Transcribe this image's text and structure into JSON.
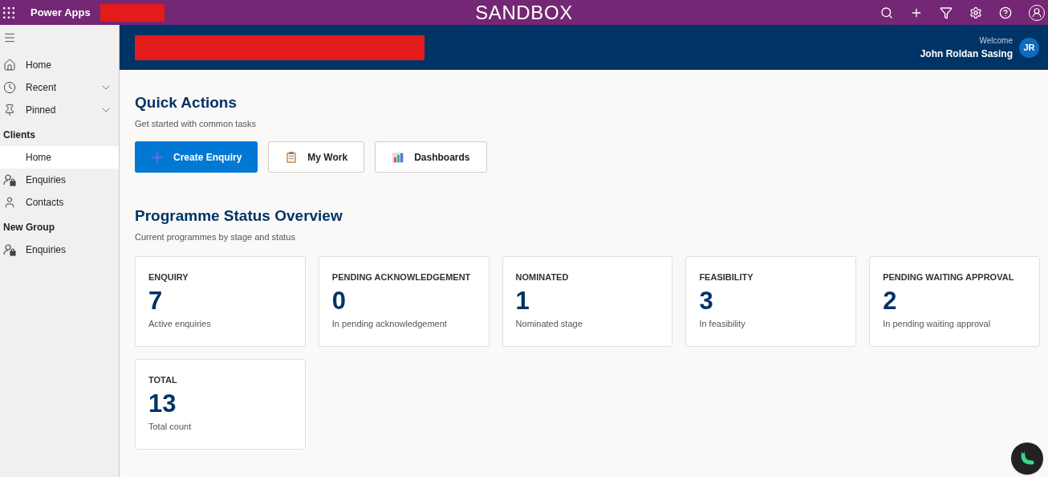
{
  "app_bar": {
    "app_name": "Power Apps",
    "environment": "SANDBOX"
  },
  "header": {
    "welcome": "Welcome",
    "user_name": "John Roldan Sasing",
    "initials": "JR"
  },
  "sidebar": {
    "items": [
      {
        "kind": "link",
        "label": "Home",
        "selected": false
      },
      {
        "kind": "expandable",
        "label": "Recent",
        "selected": false,
        "expanded": false
      },
      {
        "kind": "expandable",
        "label": "Pinned",
        "selected": false,
        "expanded": false
      },
      {
        "kind": "group",
        "label": "Clients"
      },
      {
        "kind": "link",
        "label": "Home",
        "selected": true
      },
      {
        "kind": "link",
        "label": "Enquiries",
        "selected": false
      },
      {
        "kind": "link",
        "label": "Contacts",
        "selected": false
      },
      {
        "kind": "group",
        "label": "New Group"
      },
      {
        "kind": "link",
        "label": "Enquiries",
        "selected": false
      }
    ]
  },
  "quick_actions": {
    "title": "Quick Actions",
    "subtitle": "Get started with common tasks",
    "buttons": [
      {
        "label": "Create Enquiry",
        "kind": "primary"
      },
      {
        "label": "My Work",
        "kind": "secondary"
      },
      {
        "label": "Dashboards",
        "kind": "secondary"
      }
    ]
  },
  "status_overview": {
    "title": "Programme Status Overview",
    "subtitle": "Current programmes by stage and status",
    "cards": [
      {
        "label": "ENQUIRY",
        "value": "7",
        "caption": "Active enquiries"
      },
      {
        "label": "PENDING ACKNOWLEDGEMENT",
        "value": "0",
        "caption": "In pending acknowledgement"
      },
      {
        "label": "NOMINATED",
        "value": "1",
        "caption": "Nominated stage"
      },
      {
        "label": "FEASIBILITY",
        "value": "3",
        "caption": "In feasibility"
      },
      {
        "label": "PENDING WAITING APPROVAL",
        "value": "2",
        "caption": "In pending waiting approval"
      },
      {
        "label": "TOTAL",
        "value": "13",
        "caption": "Total count"
      }
    ]
  }
}
